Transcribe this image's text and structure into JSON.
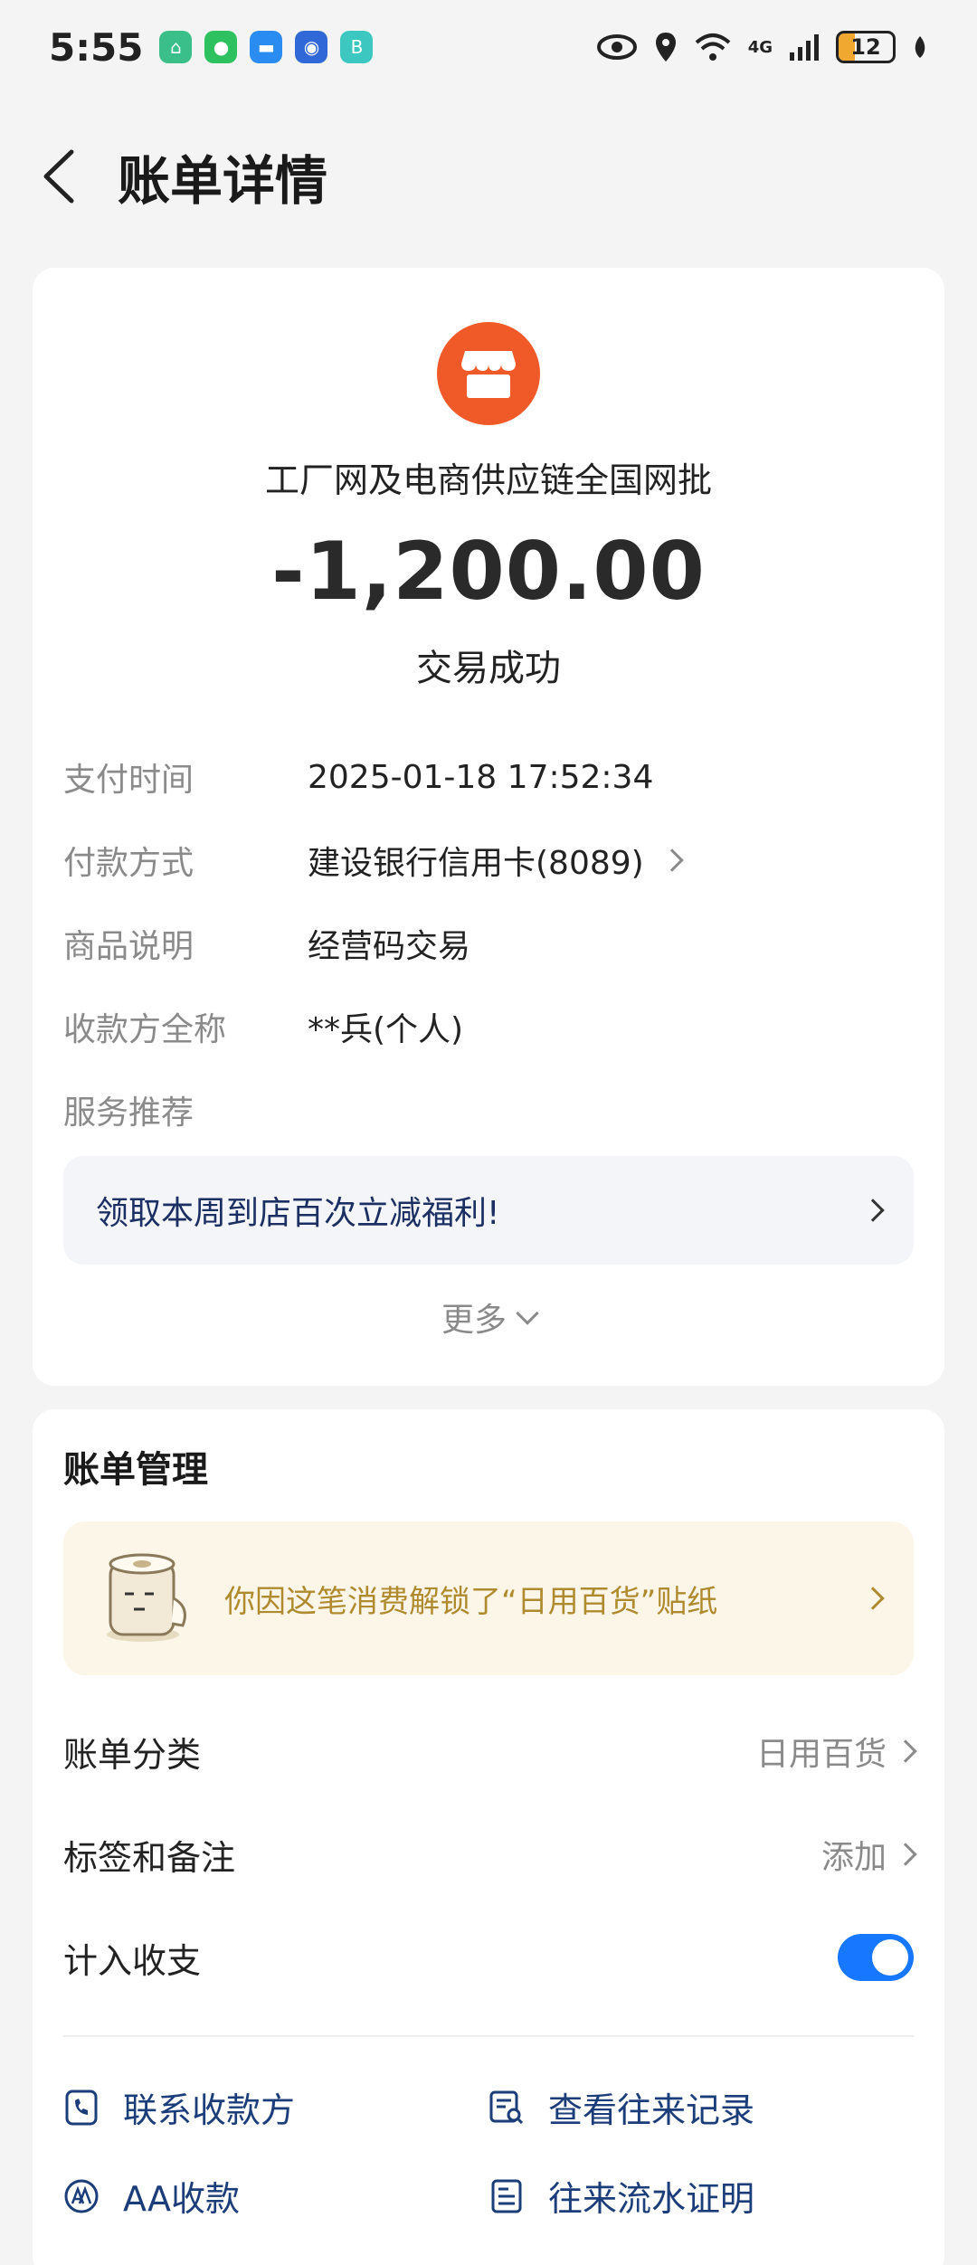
{
  "status_bar": {
    "time": "5:55",
    "network": "4G",
    "battery": "12",
    "app_icons": [
      "home-app-icon",
      "wechat-icon",
      "message-icon",
      "browser-icon",
      "app-b-icon"
    ]
  },
  "header": {
    "title": "账单详情"
  },
  "summary": {
    "merchant": "工厂网及电商供应链全国网批",
    "amount": "-1,200.00",
    "status": "交易成功",
    "logo_color": "#f05a28"
  },
  "details": [
    {
      "label": "支付时间",
      "value": "2025-01-18 17:52:34"
    },
    {
      "label": "付款方式",
      "value": "建设银行信用卡(8089)"
    },
    {
      "label": "商品说明",
      "value": "经营码交易"
    },
    {
      "label": "收款方全称",
      "value": "**兵(个人)"
    },
    {
      "label": "服务推荐",
      "value": ""
    }
  ],
  "promo": {
    "text": "领取本周到店百次立减福利!"
  },
  "more_label": "更多",
  "management": {
    "title": "账单管理",
    "sticker_text": "你因这笔消费解锁了“日用百货”贴纸",
    "category_label": "账单分类",
    "category_value": "日用百货",
    "tags_label": "标签和备注",
    "tags_value": "添加",
    "include_label": "计入收支",
    "include_on": true
  },
  "actions": {
    "contact_payee": "联系收款方",
    "view_history": "查看往来记录",
    "aa_collect": "AA收款",
    "flow_proof": "往来流水证明"
  },
  "colors": {
    "accent": "#1777ff",
    "amount": "#2a2a2a",
    "promo_text": "#1b2f63",
    "sticker_text": "#b08a2e"
  }
}
